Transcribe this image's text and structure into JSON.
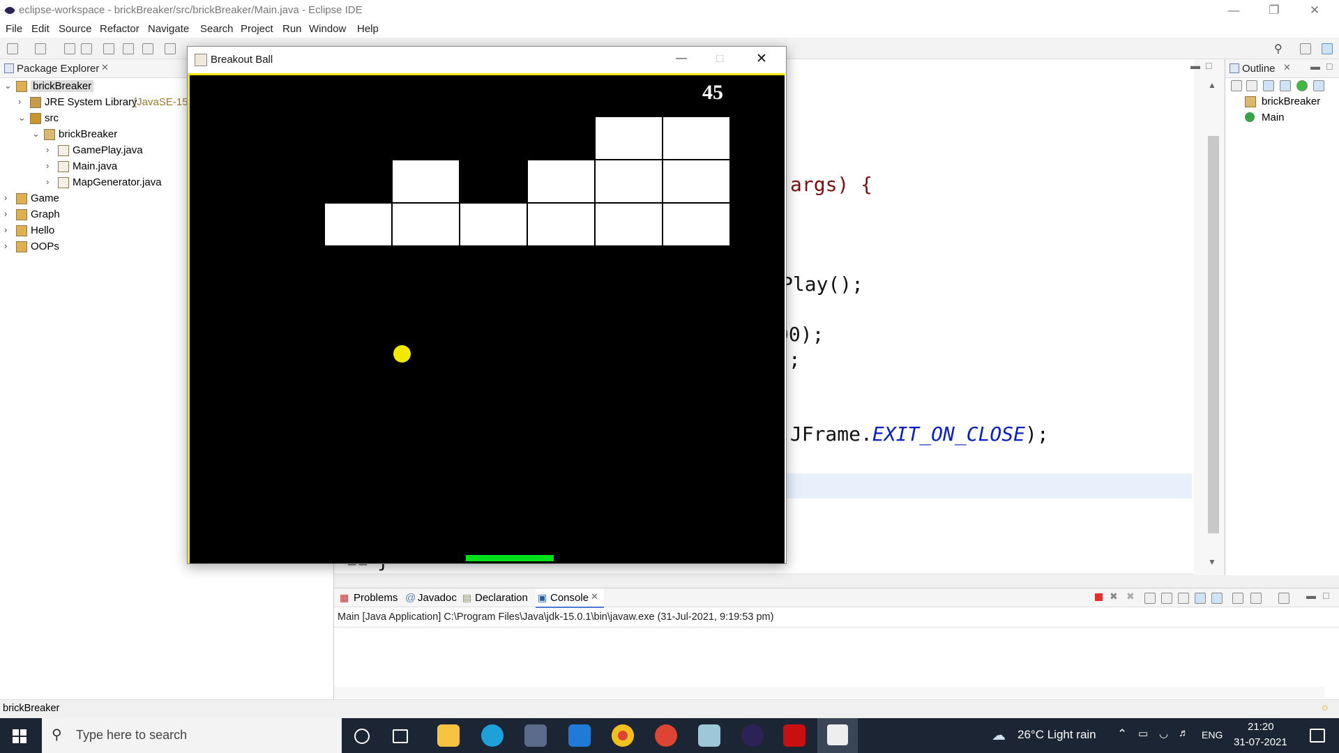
{
  "window": {
    "title": "eclipse-workspace - brickBreaker/src/brickBreaker/Main.java - Eclipse IDE"
  },
  "menu": [
    "File",
    "Edit",
    "Source",
    "Refactor",
    "Navigate",
    "Search",
    "Project",
    "Run",
    "Window",
    "Help"
  ],
  "package_explorer": {
    "tab": "Package Explorer",
    "tree": [
      {
        "label": "brickBreaker",
        "depth": 0,
        "expanded": true,
        "icon": "project-icon",
        "selected": true
      },
      {
        "label": "JRE System Library",
        "suffix": "[JavaSE-15]",
        "depth": 1,
        "expanded": false,
        "icon": "library-icon"
      },
      {
        "label": "src",
        "depth": 1,
        "expanded": true,
        "icon": "source-folder-icon"
      },
      {
        "label": "brickBreaker",
        "depth": 2,
        "expanded": true,
        "icon": "package-icon"
      },
      {
        "label": "GamePlay.java",
        "depth": 3,
        "expanded": false,
        "icon": "java-file-icon"
      },
      {
        "label": "Main.java",
        "depth": 3,
        "expanded": false,
        "icon": "java-file-icon"
      },
      {
        "label": "MapGenerator.java",
        "depth": 3,
        "expanded": false,
        "icon": "java-file-icon"
      },
      {
        "label": "Game",
        "depth": 0,
        "expanded": false,
        "icon": "project-icon"
      },
      {
        "label": "Graph",
        "depth": 0,
        "expanded": false,
        "icon": "project-icon"
      },
      {
        "label": "Hello",
        "depth": 0,
        "expanded": false,
        "icon": "project-icon"
      },
      {
        "label": "OOPs",
        "depth": 0,
        "expanded": false,
        "icon": "project-icon"
      }
    ]
  },
  "editor": {
    "visible_code": [
      "args) {",
      "Play();",
      "00);",
      ");",
      "(JFrame.",
      "EXIT_ON_CLOSE",
      ");"
    ],
    "line_number": "22",
    "closing_brace": "}"
  },
  "outline": {
    "tab": "Outline",
    "items": [
      {
        "label": "brickBreaker",
        "icon": "package-icon"
      },
      {
        "label": "Main",
        "icon": "class-icon"
      }
    ]
  },
  "console": {
    "tabs": [
      "Problems",
      "Javadoc",
      "Declaration",
      "Console"
    ],
    "active_tab": "Console",
    "header": "Main [Java Application] C:\\Program Files\\Java\\jdk-15.0.1\\bin\\javaw.exe  (31-Jul-2021, 9:19:53 pm)"
  },
  "status_bar": {
    "text": "brickBreaker"
  },
  "game_window": {
    "title": "Breakout Ball",
    "score": "45",
    "colors": {
      "border": "#f3e800",
      "ball": "#f3e800",
      "paddle": "#00e01a",
      "brick": "#ffffff",
      "background": "#000000"
    },
    "brick_grid": {
      "rows": 3,
      "cols": 6,
      "present": [
        [
          false,
          false,
          false,
          false,
          true,
          true
        ],
        [
          false,
          true,
          false,
          true,
          true,
          true
        ],
        [
          true,
          true,
          true,
          true,
          true,
          true
        ]
      ]
    }
  },
  "taskbar": {
    "search_placeholder": "Type here to search",
    "weather": "26°C  Light rain",
    "language": "ENG",
    "time": "21:20",
    "date": "31-07-2021"
  }
}
